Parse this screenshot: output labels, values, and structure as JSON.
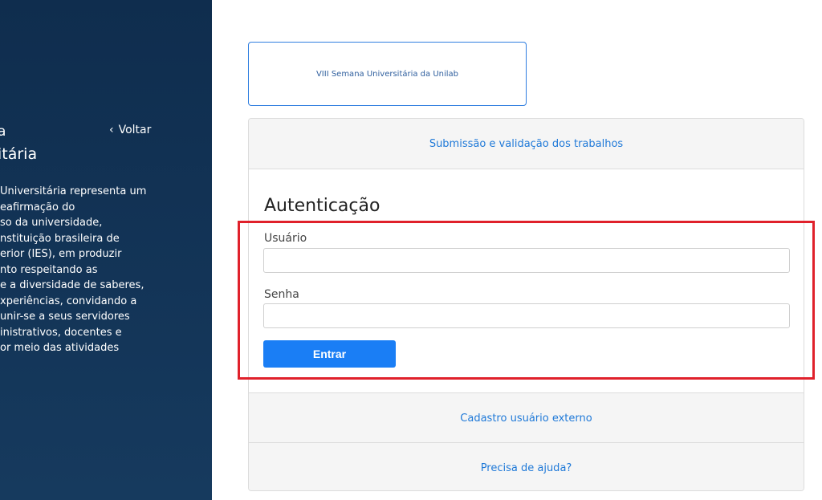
{
  "sidebar": {
    "title_line1": "a",
    "title_line2": "itária",
    "back_label": "Voltar",
    "back_icon": "chevron-left-icon",
    "description_lines": [
      "Universitária representa um",
      "eafirmação do",
      "so da universidade,",
      "nstituição brasileira de",
      "erior (IES), em produzir",
      "nto respeitando as",
      "e a diversidade de saberes,",
      "xperiências, convidando a",
      "unir-se a seus servidores",
      "inistrativos, docentes e",
      "or meio das atividades"
    ]
  },
  "event_card": {
    "label": "VIII Semana Universitária da Unilab"
  },
  "panel": {
    "top_link": "Submissão e validação dos trabalhos",
    "auth_title": "Autenticação",
    "username_label": "Usuário",
    "username_value": "",
    "password_label": "Senha",
    "password_value": "",
    "submit_label": "Entrar",
    "register_link": "Cadastro usuário externo",
    "help_link": "Precisa de ajuda?"
  },
  "colors": {
    "sidebar_bg": "#0f2d4e",
    "accent": "#1a7ef5",
    "link": "#1f79d8",
    "highlight": "#e0212b"
  }
}
